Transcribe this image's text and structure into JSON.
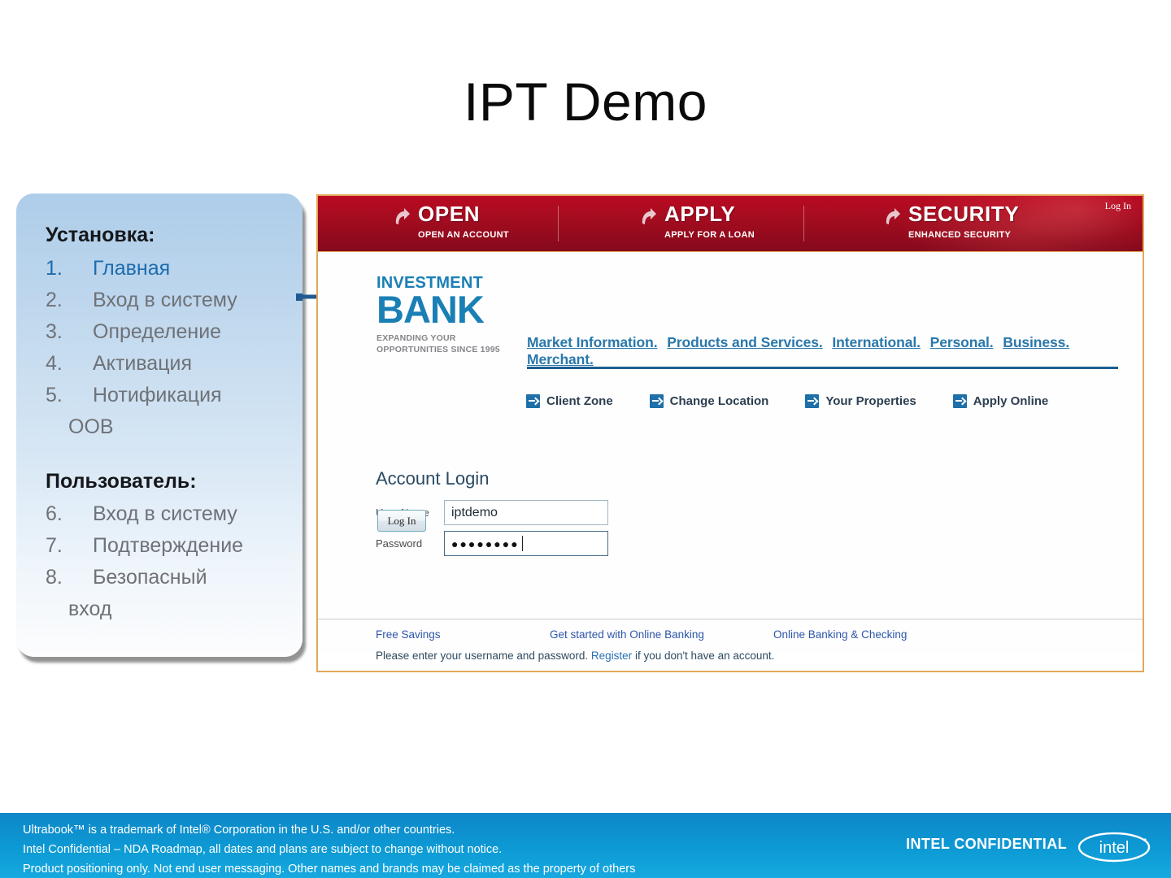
{
  "slide": {
    "title": "IPT Demo"
  },
  "callout": {
    "setup_heading": "Установка:",
    "setup_items": [
      {
        "num": "1.",
        "label": "Главная",
        "highlight": true
      },
      {
        "num": "2.",
        "label": "Вход в систему",
        "highlight": false
      },
      {
        "num": "3.",
        "label": "Определение",
        "highlight": false
      },
      {
        "num": "4.",
        "label": "Активация",
        "highlight": false
      },
      {
        "num": "5.",
        "label": "Нотификация",
        "highlight": false
      }
    ],
    "setup_continuation": "ООВ",
    "user_heading": "Пользователь:",
    "user_items": [
      {
        "num": "6.",
        "label": "Вход в систему"
      },
      {
        "num": "7.",
        "label": "Подтверждение"
      },
      {
        "num": "8.",
        "label": "Безопасный"
      }
    ],
    "user_continuation": "вход",
    "accent_color": "#1c6cb0",
    "text_color": "#6f7277"
  },
  "bank_page": {
    "border_color": "#e2a859",
    "hero": {
      "background_color": "#a50c20",
      "login_link": "Log In",
      "items": [
        {
          "title": "OPEN",
          "subtitle": "OPEN AN ACCOUNT",
          "icon": "curved-arrow-icon"
        },
        {
          "title": "APPLY",
          "subtitle": "APPLY FOR A LOAN",
          "icon": "curved-arrow-icon"
        },
        {
          "title": "SECURITY",
          "subtitle": "ENHANCED SECURITY",
          "icon": "curved-arrow-icon"
        }
      ]
    },
    "logo": {
      "line1": "INVESTMENT",
      "line2": "BANK",
      "tagline_line1": "EXPANDING YOUR",
      "tagline_line2": "OPPORTUNITIES SINCE 1995",
      "color": "#1a7fb5"
    },
    "headline_links": [
      "Market Information.",
      "Products and Services.",
      "International.",
      "Personal.",
      "Business.",
      "Merchant."
    ],
    "nav_links": [
      {
        "label": "Client Zone",
        "icon": "arrow-right-box-icon"
      },
      {
        "label": "Change Location",
        "icon": "arrow-right-box-icon"
      },
      {
        "label": "Your Properties",
        "icon": "arrow-right-box-icon"
      },
      {
        "label": "Apply Online",
        "icon": "arrow-right-box-icon"
      }
    ],
    "login_form": {
      "heading": "Account Login",
      "username_label": "User Name",
      "username_value": "iptdemo",
      "password_label": "Password",
      "password_masked": "●●●●●●●●",
      "submit_label": "Log In",
      "hint_before": "Please enter your username and password. ",
      "hint_link": "Register",
      "hint_after": " if you don't have an account."
    },
    "footer_links": [
      "Free Savings",
      "Get started with Online Banking",
      "Online Banking & Checking"
    ]
  },
  "intel_footer": {
    "legal_line1": "Ultrabook™ is a trademark of Intel® Corporation in the U.S. and/or other countries.",
    "legal_line2": "Intel Confidential – NDA Roadmap, all dates and plans are subject to change without notice.",
    "legal_line3": "Product positioning only. Not end user messaging. Other names and brands may be claimed as the property of others",
    "confidential_label": "INTEL CONFIDENTIAL",
    "logo_text": "intel",
    "background_color": "#0d9ad4"
  }
}
